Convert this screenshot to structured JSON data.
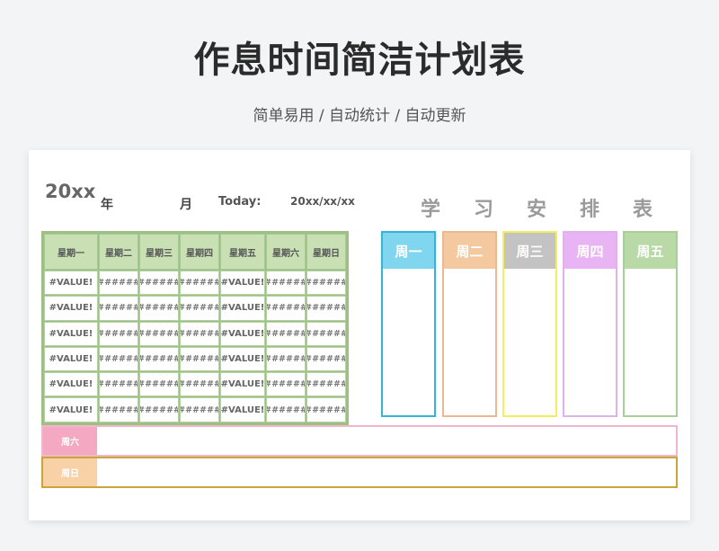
{
  "title": "作息时间简洁计划表",
  "subtitle": "简单易用 / 自动统计 / 自动更新",
  "sheet": {
    "year": "20xx",
    "year_unit": "年",
    "month_unit": "月",
    "today_label": "Today:",
    "today_value": "20xx/xx/xx",
    "study_title": [
      "学",
      "习",
      "安",
      "排",
      "表"
    ]
  },
  "calendar": {
    "headers": [
      "星期一",
      "星期二",
      "星期三",
      "星期四",
      "星期五",
      "星期六",
      "星期日"
    ],
    "rows": [
      [
        "#VALUE!",
        "######",
        "######",
        "######",
        "#VALUE!",
        "######",
        "######"
      ],
      [
        "#VALUE!",
        "######",
        "######",
        "######",
        "#VALUE!",
        "######",
        "######"
      ],
      [
        "#VALUE!",
        "######",
        "######",
        "######",
        "#VALUE!",
        "######",
        "######"
      ],
      [
        "#VALUE!",
        "######",
        "######",
        "######",
        "#VALUE!",
        "######",
        "######"
      ],
      [
        "#VALUE!",
        "######",
        "######",
        "######",
        "#VALUE!",
        "######",
        "######"
      ],
      [
        "#VALUE!",
        "######",
        "######",
        "######",
        "#VALUE!",
        "######",
        "######"
      ]
    ]
  },
  "weekdays": [
    {
      "label": "周一",
      "color": "#7fd6ee",
      "border": "#34b4d9"
    },
    {
      "label": "周二",
      "color": "#f5c9a0",
      "border": "#eab892"
    },
    {
      "label": "周三",
      "color": "#c3c3c3",
      "border": "#f3ee5a"
    },
    {
      "label": "周四",
      "color": "#e9b4f3",
      "border": "#e0b2ea"
    },
    {
      "label": "周五",
      "color": "#b9d9a7",
      "border": "#a9cf99"
    }
  ],
  "weekend": [
    {
      "label": "周六",
      "color": "#f4a8c2",
      "border": "#f0b7c9"
    },
    {
      "label": "周日",
      "color": "#f8d2a6",
      "border": "#c9a53a"
    }
  ]
}
